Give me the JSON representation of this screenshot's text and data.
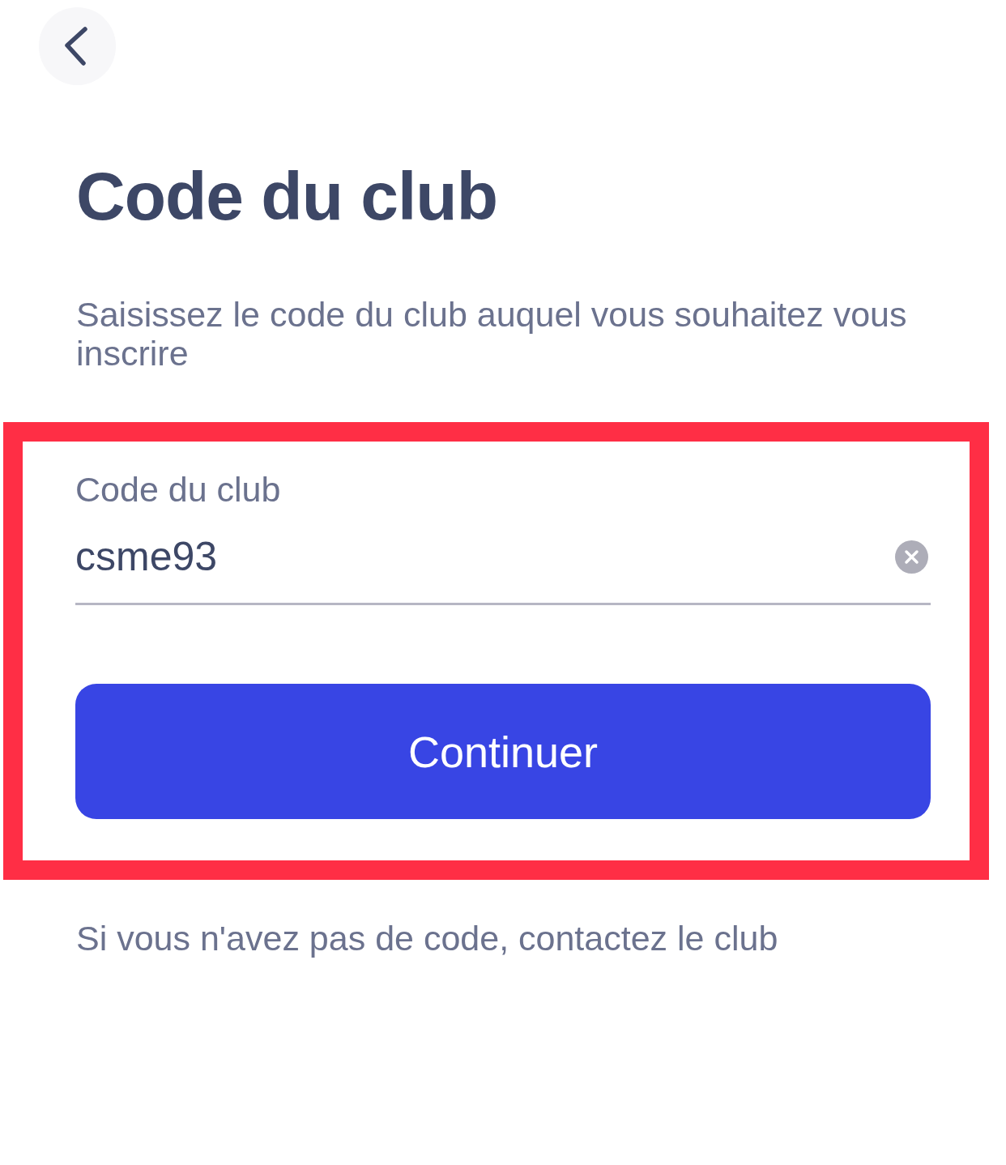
{
  "header": {
    "title": "Code du club",
    "subtitle": "Saisissez le code du club auquel vous souhaitez vous inscrire"
  },
  "form": {
    "highlighted": true,
    "field": {
      "label": "Code du club",
      "value": "csme93",
      "clearable": true
    },
    "button": {
      "label": "Continuer"
    }
  },
  "footer_note": "Si vous n'avez pas de code, contactez le club"
}
